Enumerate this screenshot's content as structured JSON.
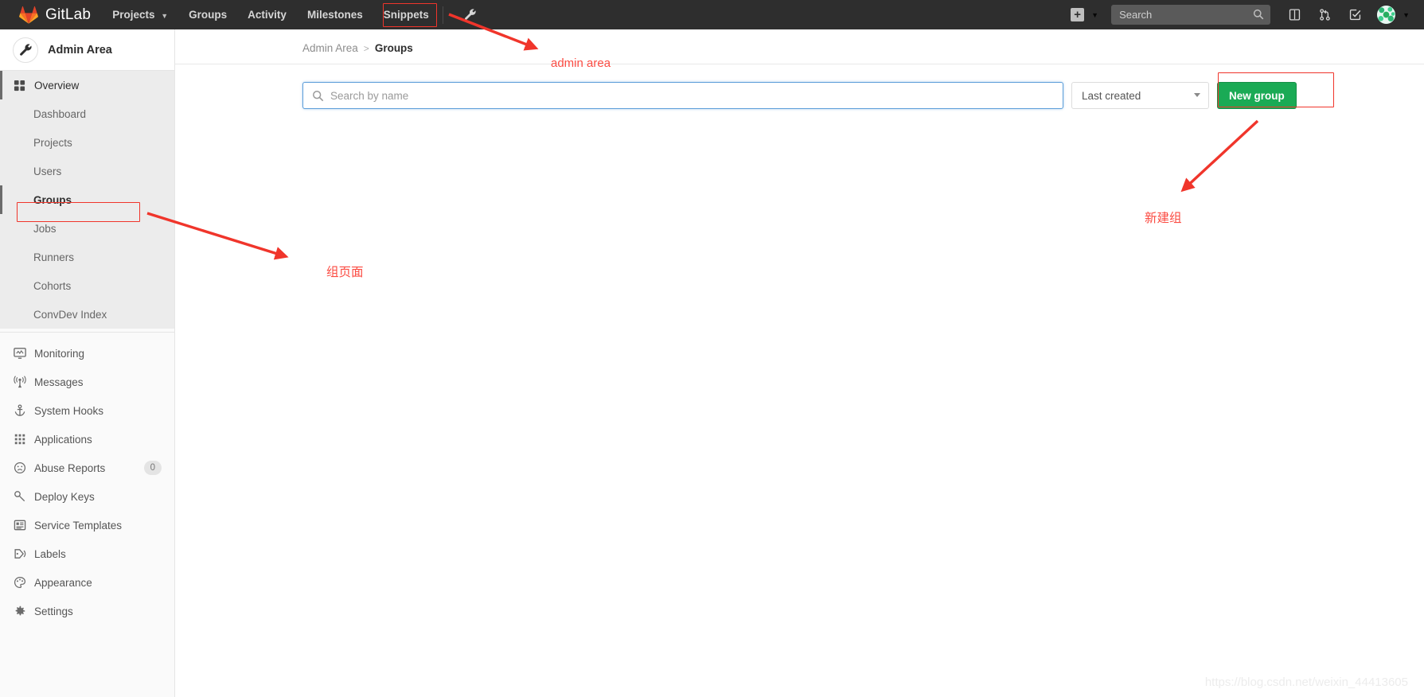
{
  "navbar": {
    "brand": "GitLab",
    "brand_icon": "gitlab-logo-icon",
    "links": [
      {
        "label": "Projects",
        "has_caret": true,
        "icon": "chevron-down-icon"
      },
      {
        "label": "Groups",
        "has_caret": false
      },
      {
        "label": "Activity",
        "has_caret": false
      },
      {
        "label": "Milestones",
        "has_caret": false
      },
      {
        "label": "Snippets",
        "has_caret": false
      }
    ],
    "wrench_icon": "wrench-icon",
    "plus": {
      "label": "+",
      "icon": "plus-icon",
      "caret_icon": "chevron-down-icon"
    },
    "search": {
      "placeholder": "Search",
      "value": "",
      "icon": "search-icon"
    },
    "icons": [
      {
        "name": "issues-icon"
      },
      {
        "name": "merge-requests-icon"
      },
      {
        "name": "todos-icon"
      }
    ],
    "avatar": {
      "name": "user-avatar",
      "caret_icon": "chevron-down-icon"
    }
  },
  "sidebar": {
    "title": "Admin Area",
    "title_icon": "wrench-icon",
    "overview": {
      "label": "Overview",
      "icon": "overview-grid-icon"
    },
    "overview_items": [
      {
        "label": "Dashboard",
        "active": false
      },
      {
        "label": "Projects",
        "active": false
      },
      {
        "label": "Users",
        "active": false
      },
      {
        "label": "Groups",
        "active": true
      },
      {
        "label": "Jobs",
        "active": false
      },
      {
        "label": "Runners",
        "active": false
      },
      {
        "label": "Cohorts",
        "active": false
      },
      {
        "label": "ConvDev Index",
        "active": false
      }
    ],
    "items": [
      {
        "label": "Monitoring",
        "icon": "monitor-icon",
        "badge": null
      },
      {
        "label": "Messages",
        "icon": "broadcast-icon",
        "badge": null
      },
      {
        "label": "System Hooks",
        "icon": "anchor-icon",
        "badge": null
      },
      {
        "label": "Applications",
        "icon": "applications-grid-icon",
        "badge": null
      },
      {
        "label": "Abuse Reports",
        "icon": "face-icon",
        "badge": "0"
      },
      {
        "label": "Deploy Keys",
        "icon": "key-icon",
        "badge": null
      },
      {
        "label": "Service Templates",
        "icon": "template-icon",
        "badge": null
      },
      {
        "label": "Labels",
        "icon": "label-tag-icon",
        "badge": null
      },
      {
        "label": "Appearance",
        "icon": "palette-icon",
        "badge": null
      },
      {
        "label": "Settings",
        "icon": "gear-icon",
        "badge": null
      }
    ]
  },
  "breadcrumb": {
    "root": "Admin Area",
    "separator": ">",
    "current": "Groups"
  },
  "toolbar": {
    "search": {
      "placeholder": "Search by name",
      "value": "",
      "icon": "search-icon"
    },
    "sort": {
      "selected": "Last created",
      "caret_icon": "chevron-down-icon"
    },
    "new_group_label": "New group"
  },
  "annotations": [
    {
      "name": "annotation-admin-area",
      "text": "admin area"
    },
    {
      "name": "annotation-groups-page",
      "text": "组页面"
    },
    {
      "name": "annotation-new-group",
      "text": "新建组"
    }
  ],
  "watermark": "https://blog.csdn.net/weixin_44413605",
  "colors": {
    "navbar_bg": "#2e2e2e",
    "sidebar_bg": "#fafafa",
    "accent_green": "#1aaa55",
    "annotation_red": "#fb4b42",
    "focus_blue": "#5b9dd9"
  }
}
